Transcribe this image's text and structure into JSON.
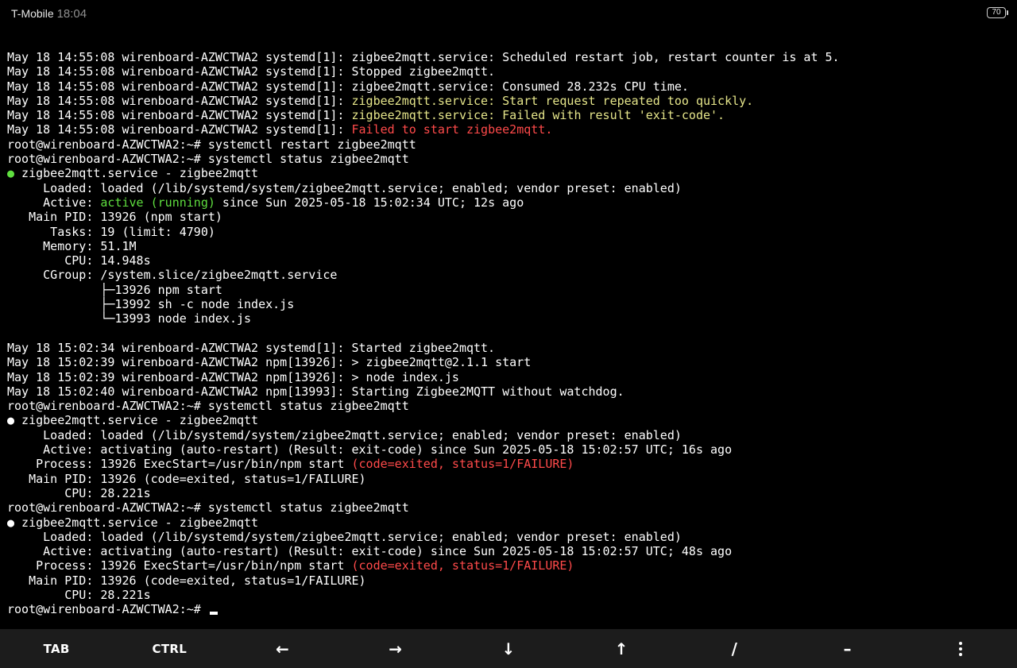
{
  "status_bar": {
    "carrier": "T-Mobile",
    "time": "18:04",
    "battery": "70"
  },
  "colors": {
    "background": "#000000",
    "text": "#ffffff",
    "warning": "#e5e58a",
    "error": "#ff4a4a",
    "ok": "#5fdf3f"
  },
  "terminal": {
    "lines": [
      [
        {
          "t": "May 18 14:55:08 wirenboard-AZWCTWA2 systemd[1]: zigbee2mqtt.service: Scheduled restart job, restart counter is at 5."
        }
      ],
      [
        {
          "t": "May 18 14:55:08 wirenboard-AZWCTWA2 systemd[1]: Stopped zigbee2mqtt."
        }
      ],
      [
        {
          "t": "May 18 14:55:08 wirenboard-AZWCTWA2 systemd[1]: zigbee2mqtt.service: Consumed 28.232s CPU time."
        }
      ],
      [
        {
          "t": "May 18 14:55:08 wirenboard-AZWCTWA2 systemd[1]: "
        },
        {
          "t": "zigbee2mqtt.service: Start request repeated too quickly.",
          "c": "y"
        }
      ],
      [
        {
          "t": "May 18 14:55:08 wirenboard-AZWCTWA2 systemd[1]: "
        },
        {
          "t": "zigbee2mqtt.service: Failed with result 'exit-code'.",
          "c": "y"
        }
      ],
      [
        {
          "t": "May 18 14:55:08 wirenboard-AZWCTWA2 systemd[1]: "
        },
        {
          "t": "Failed to start zigbee2mqtt.",
          "c": "r"
        }
      ],
      [
        {
          "t": "root@wirenboard-AZWCTWA2:~# systemctl restart zigbee2mqtt"
        }
      ],
      [
        {
          "t": "root@wirenboard-AZWCTWA2:~# systemctl status zigbee2mqtt"
        }
      ],
      [
        {
          "t": "●",
          "c": "g"
        },
        {
          "t": " zigbee2mqtt.service - zigbee2mqtt"
        }
      ],
      [
        {
          "t": "     Loaded: loaded (/lib/systemd/system/zigbee2mqtt.service; enabled; vendor preset: enabled)"
        }
      ],
      [
        {
          "t": "     Active: "
        },
        {
          "t": "active (running)",
          "c": "g"
        },
        {
          "t": " since Sun 2025-05-18 15:02:34 UTC; 12s ago"
        }
      ],
      [
        {
          "t": "   Main PID: 13926 (npm start)"
        }
      ],
      [
        {
          "t": "      Tasks: 19 (limit: 4790)"
        }
      ],
      [
        {
          "t": "     Memory: 51.1M"
        }
      ],
      [
        {
          "t": "        CPU: 14.948s"
        }
      ],
      [
        {
          "t": "     CGroup: /system.slice/zigbee2mqtt.service"
        }
      ],
      [
        {
          "t": "             ├─13926 npm start"
        }
      ],
      [
        {
          "t": "             ├─13992 sh -c node index.js"
        }
      ],
      [
        {
          "t": "             └─13993 node index.js"
        }
      ],
      [
        {
          "t": ""
        }
      ],
      [
        {
          "t": "May 18 15:02:34 wirenboard-AZWCTWA2 systemd[1]: Started zigbee2mqtt."
        }
      ],
      [
        {
          "t": "May 18 15:02:39 wirenboard-AZWCTWA2 npm[13926]: > zigbee2mqtt@2.1.1 start"
        }
      ],
      [
        {
          "t": "May 18 15:02:39 wirenboard-AZWCTWA2 npm[13926]: > node index.js"
        }
      ],
      [
        {
          "t": "May 18 15:02:40 wirenboard-AZWCTWA2 npm[13993]: Starting Zigbee2MQTT without watchdog."
        }
      ],
      [
        {
          "t": "root@wirenboard-AZWCTWA2:~# systemctl status zigbee2mqtt"
        }
      ],
      [
        {
          "t": "● zigbee2mqtt.service - zigbee2mqtt"
        }
      ],
      [
        {
          "t": "     Loaded: loaded (/lib/systemd/system/zigbee2mqtt.service; enabled; vendor preset: enabled)"
        }
      ],
      [
        {
          "t": "     Active: activating (auto-restart) (Result: exit-code) since Sun 2025-05-18 15:02:57 UTC; 16s ago"
        }
      ],
      [
        {
          "t": "    Process: 13926 ExecStart=/usr/bin/npm start "
        },
        {
          "t": "(code=exited, status=1/FAILURE)",
          "c": "r"
        }
      ],
      [
        {
          "t": "   Main PID: 13926 (code=exited, status=1/FAILURE)"
        }
      ],
      [
        {
          "t": "        CPU: 28.221s"
        }
      ],
      [
        {
          "t": "root@wirenboard-AZWCTWA2:~# systemctl status zigbee2mqtt"
        }
      ],
      [
        {
          "t": "● zigbee2mqtt.service - zigbee2mqtt"
        }
      ],
      [
        {
          "t": "     Loaded: loaded (/lib/systemd/system/zigbee2mqtt.service; enabled; vendor preset: enabled)"
        }
      ],
      [
        {
          "t": "     Active: activating (auto-restart) (Result: exit-code) since Sun 2025-05-18 15:02:57 UTC; 48s ago"
        }
      ],
      [
        {
          "t": "    Process: 13926 ExecStart=/usr/bin/npm start "
        },
        {
          "t": "(code=exited, status=1/FAILURE)",
          "c": "r"
        }
      ],
      [
        {
          "t": "   Main PID: 13926 (code=exited, status=1/FAILURE)"
        }
      ],
      [
        {
          "t": "        CPU: 28.221s"
        }
      ]
    ],
    "prompt": "root@wirenboard-AZWCTWA2:~# "
  },
  "extra_keys": [
    {
      "name": "tab-key",
      "label": "TAB"
    },
    {
      "name": "ctrl-key",
      "label": "CTRL"
    },
    {
      "name": "left-arrow-key",
      "label": "←",
      "arrow": true
    },
    {
      "name": "right-arrow-key",
      "label": "→",
      "arrow": true
    },
    {
      "name": "down-arrow-key",
      "label": "↓",
      "arrow": true
    },
    {
      "name": "up-arrow-key",
      "label": "↑",
      "arrow": true
    },
    {
      "name": "slash-key",
      "label": "/",
      "arrow": true
    },
    {
      "name": "dash-key",
      "label": "–",
      "arrow": true
    },
    {
      "name": "more-options-key",
      "label": "",
      "icon": "more-vertical-icon"
    }
  ]
}
